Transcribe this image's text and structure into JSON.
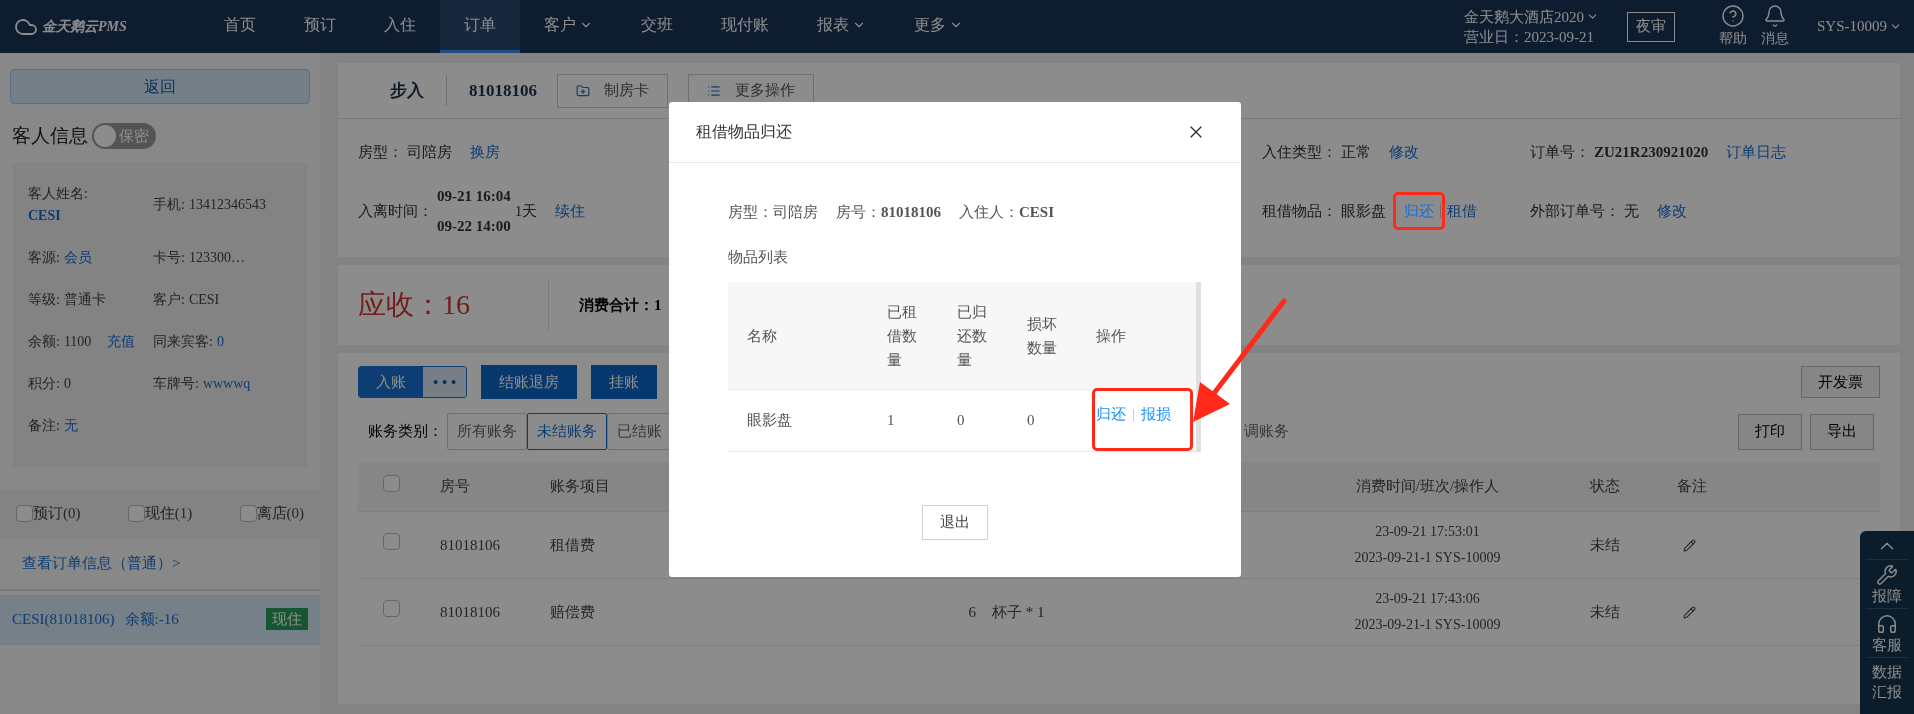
{
  "nav": {
    "logo": "金天鹅云PMS",
    "items": [
      {
        "label": "首页",
        "selected": false,
        "dropdown": false
      },
      {
        "label": "预订",
        "selected": false,
        "dropdown": false
      },
      {
        "label": "入住",
        "selected": false,
        "dropdown": false
      },
      {
        "label": "订单",
        "selected": true,
        "dropdown": false
      },
      {
        "label": "客户",
        "selected": false,
        "dropdown": true
      },
      {
        "label": "交班",
        "selected": false,
        "dropdown": false
      },
      {
        "label": "现付账",
        "selected": false,
        "dropdown": false
      },
      {
        "label": "报表",
        "selected": false,
        "dropdown": true
      },
      {
        "label": "更多",
        "selected": false,
        "dropdown": true
      }
    ],
    "hotel": "金天鹅大酒店2020",
    "business_date": "营业日：2023-09-21",
    "night_audit": "夜审",
    "help": "帮助",
    "messages": "消息",
    "user": "SYS-10009"
  },
  "sidebar": {
    "back": "返回",
    "guest_info_title": "客人信息",
    "privacy_toggle": {
      "label": "保密",
      "on": false
    },
    "fields": [
      {
        "label": "客人姓名:",
        "value": "CESI",
        "link": true,
        "stacked": true
      },
      {
        "label": "手机:",
        "value": "13412346543",
        "link": false,
        "stacked": false
      },
      {
        "label": "客源:",
        "value": "会员",
        "link": true,
        "stacked": false
      },
      {
        "label": "卡号:",
        "value": "123300…",
        "link": false,
        "stacked": false
      },
      {
        "label": "等级:",
        "value": "普通卡",
        "link": false,
        "stacked": false
      },
      {
        "label": "客户:",
        "value": "CESI",
        "link": false,
        "stacked": false
      },
      {
        "label": "余额:",
        "value": "1100",
        "link": false,
        "stacked": false,
        "action": "充值"
      },
      {
        "label": "同来宾客:",
        "value": "0",
        "link": true,
        "stacked": false
      },
      {
        "label": "积分:",
        "value": "0",
        "link": false,
        "stacked": false
      },
      {
        "label": "车牌号:",
        "value": "wwwwq",
        "link": true,
        "stacked": false
      },
      {
        "label": "备注:",
        "value": "无",
        "link": true,
        "stacked": false
      }
    ],
    "filters": [
      {
        "label": "预订(0)",
        "checked": false
      },
      {
        "label": "现住(1)",
        "checked": false
      },
      {
        "label": "离店(0)",
        "checked": false
      }
    ],
    "order_link": "查看订单信息（普通）>",
    "guests": [
      {
        "name": "CESI(81018106)",
        "balance": "余额:-16",
        "status": "现住",
        "selected": true
      }
    ]
  },
  "order_header": {
    "title": "步入",
    "room": "81018106",
    "buttons": [
      {
        "label": "制房卡",
        "kind": "card"
      },
      {
        "label": "更多操作",
        "kind": "menu"
      }
    ]
  },
  "order_info": [
    {
      "left": {
        "label": "房型：",
        "lines": [
          "司陪房"
        ],
        "bold": false,
        "actions": [
          {
            "label": "换房",
            "annotated": false
          }
        ]
      },
      "right": [
        {
          "label": "入住类型：",
          "lines": [
            "正常"
          ],
          "bold": false,
          "actions": [
            {
              "label": "修改",
              "annotated": false
            }
          ]
        },
        {
          "label": "订单号：",
          "lines": [
            "ZU21R230921020"
          ],
          "bold": true,
          "actions": [
            {
              "label": "订单日志",
              "annotated": false
            }
          ]
        }
      ]
    },
    {
      "left": {
        "label": "入离时间：",
        "lines": [
          "09-21 16:04",
          "09-22 14:00"
        ],
        "bold": true,
        "suffix": "1天",
        "actions": [
          {
            "label": "续住",
            "annotated": false
          }
        ]
      },
      "right": [
        {
          "label": "租借物品：",
          "lines": [
            "眼影盘"
          ],
          "bold": false,
          "actions": [
            {
              "label": "归还",
              "annotated": true
            },
            {
              "label": "租借",
              "annotated": false
            }
          ]
        },
        {
          "label": "外部订单号：",
          "lines": [
            "无"
          ],
          "bold": false,
          "actions": [
            {
              "label": "修改",
              "annotated": false
            }
          ]
        }
      ]
    }
  ],
  "summary": {
    "receivable": "应收：16",
    "total": "消费合计：1"
  },
  "bills": {
    "actions": [
      {
        "label": "入账",
        "kind": "split",
        "more": "• • •"
      },
      {
        "label": "结账退房",
        "kind": "primary"
      },
      {
        "label": "挂账",
        "kind": "primary"
      }
    ],
    "invoice": "开发票",
    "filter_label": "账务类别：",
    "filters": [
      {
        "label": "所有账务",
        "selected": false
      },
      {
        "label": "未结账务",
        "selected": true
      },
      {
        "label": "已结账",
        "selected": false
      }
    ],
    "hidden_filter": {
      "label": "调账务",
      "selected": false
    },
    "print": "打印",
    "export": "导出",
    "all_checked": false,
    "columns": [
      "房号",
      "账务项目",
      "消费时间/班次/操作人",
      "状态",
      "备注"
    ],
    "rows": [
      {
        "checked": false,
        "room": "81018106",
        "item": "租借费",
        "time": "23-09-21 17:53:01",
        "shift": "2023-09-21-1 SYS-10009",
        "status": "未结"
      },
      {
        "checked": false,
        "room": "81018106",
        "item": "赔偿费",
        "amount": "6",
        "detail": "杯子 * 1",
        "time": "23-09-21 17:43:06",
        "shift": "2023-09-21-1 SYS-10009",
        "status": "未结"
      }
    ]
  },
  "float_toolbar": [
    {
      "label": "报障",
      "kind": "wrench"
    },
    {
      "label": "客服",
      "kind": "headset"
    },
    {
      "label": "数据汇报",
      "kind": "chart"
    }
  ],
  "modal": {
    "title": "租借物品归还",
    "info": [
      {
        "label": "房型：",
        "value": "司陪房",
        "bold": false
      },
      {
        "label": "房号：",
        "value": "81018106",
        "bold": true
      },
      {
        "label": "入住人：",
        "value": "CESI",
        "bold": true
      }
    ],
    "list_title": "物品列表",
    "columns": [
      "名称",
      "已租借数量",
      "已归还数量",
      "损坏数量",
      "操作"
    ],
    "rows": [
      {
        "name": "眼影盘",
        "rented": "1",
        "returned": "0",
        "damaged": "0",
        "actions": [
          "归还",
          "报损"
        ],
        "annotated": true
      }
    ],
    "exit": "退出"
  }
}
